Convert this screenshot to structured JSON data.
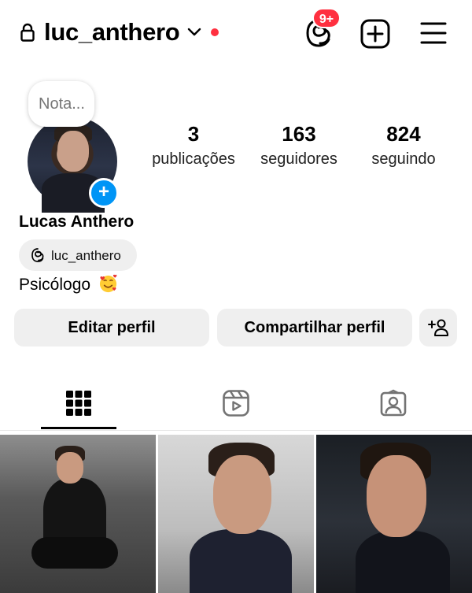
{
  "header": {
    "username": "luc_anthero",
    "notification_badge": "9+",
    "status_dot_color": "#ff3040"
  },
  "profile": {
    "note_placeholder": "Nota...",
    "full_name": "Lucas Anthero",
    "threads_handle": "luc_anthero",
    "bio": "Psicólogo",
    "bio_emoji": "smiling-face-with-hearts",
    "stats": [
      {
        "value": "3",
        "label": "publicações"
      },
      {
        "value": "163",
        "label": "seguidores"
      },
      {
        "value": "824",
        "label": "seguindo"
      }
    ]
  },
  "actions": {
    "edit_label": "Editar perfil",
    "share_label": "Compartilhar perfil",
    "add_icon": "add-person-icon"
  },
  "tabs": [
    {
      "icon": "grid-icon",
      "active": true
    },
    {
      "icon": "reels-icon",
      "active": false
    },
    {
      "icon": "tagged-icon",
      "active": false
    }
  ],
  "colors": {
    "accent": "#0095f6",
    "badge": "#ff3040",
    "button_bg": "#efefef"
  }
}
